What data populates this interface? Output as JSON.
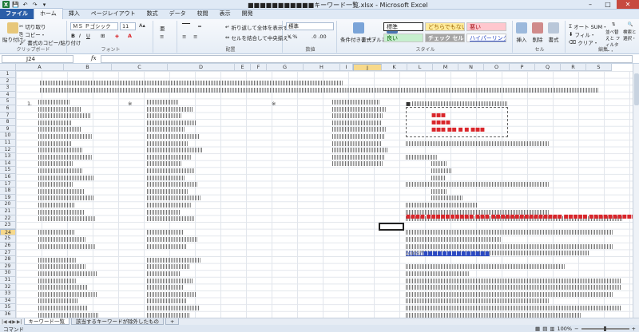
{
  "window": {
    "title": "■■■■■■■■■■■キーワード一覧.xlsx - Microsoft Excel",
    "minimize": "–",
    "maximize": "□",
    "close": "✕"
  },
  "tabs": [
    "ファイル",
    "ホーム",
    "挿入",
    "ページレイアウト",
    "数式",
    "データ",
    "校閲",
    "表示",
    "開発"
  ],
  "ribbon": {
    "clipboard": {
      "paste": "貼り付け",
      "cut": "切り取り",
      "copy": "コピー・",
      "format_painter": "書式のコピー/貼り付け",
      "label": "クリップボード"
    },
    "font": {
      "name": "ＭＳ Ｐゴシック",
      "size": "11",
      "label": "フォント"
    },
    "alignment": {
      "wrap": "折り返して全体を表示する",
      "merge": "セルを結合して中央揃え・",
      "label": "配置"
    },
    "number": {
      "format": "標準",
      "label": "数値"
    },
    "styles": {
      "conditional": "条件付き書式・",
      "table": "テーブルとして書式設定・",
      "normal": "標準",
      "neutral": "どちらでもない",
      "bad": "悪い",
      "good": "良い",
      "check": "チェック セル",
      "hyperlink": "ハイパーリンク",
      "label": "スタイル"
    },
    "cells": {
      "insert": "挿入",
      "delete": "削除",
      "format": "書式",
      "label": "セル"
    },
    "editing": {
      "autosum": "オート SUM・",
      "fill": "フィル・",
      "clear": "クリア・",
      "sort": "並べ替えと フィルター・",
      "find": "検索と 選択・",
      "label": "編集"
    }
  },
  "formula_bar": {
    "name_box": "J24",
    "fx": "fx",
    "value": ""
  },
  "columns": [
    "A",
    "B",
    "C",
    "D",
    "E",
    "F",
    "G",
    "H",
    "I",
    "J",
    "K",
    "L",
    "M",
    "N",
    "O",
    "P",
    "Q",
    "R",
    "S"
  ],
  "rows": [
    "1",
    "2",
    "3",
    "4",
    "5",
    "6",
    "7",
    "8",
    "9",
    "10",
    "11",
    "12",
    "13",
    "14",
    "15",
    "16",
    "17",
    "18",
    "19",
    "20",
    "21",
    "22",
    "23",
    "24",
    "25",
    "26",
    "27",
    "28",
    "29",
    "30",
    "31",
    "32",
    "33",
    "34",
    "35",
    "36"
  ],
  "selected": {
    "column": "J",
    "row": "24"
  },
  "cells": {
    "a5": "1.",
    "c5": "※",
    "e5": "※",
    "k5": "■",
    "red1": "■■■",
    "red2": "■■■■",
    "red3": "■■■ ■■ ■ ■ ■■■",
    "k23_red": "■■■■ ■■■■■■■■■■ ■■■ ■■■■■■■■■■■■■■■ ■■■■■ ■■■■■■■■■■",
    "k28_link": "https://■■■■■■■■■■■■■■"
  },
  "sheets": [
    "キーワード一覧",
    "該当するキーワードが除外したもの",
    "+"
  ],
  "status": {
    "ready": "コマンド",
    "zoom": "100%"
  },
  "colors": {
    "accent": "#2a5ea8",
    "excel_green": "#1d7a3a",
    "selected_header": "#f7d98b",
    "red_text": "#d9262b"
  }
}
